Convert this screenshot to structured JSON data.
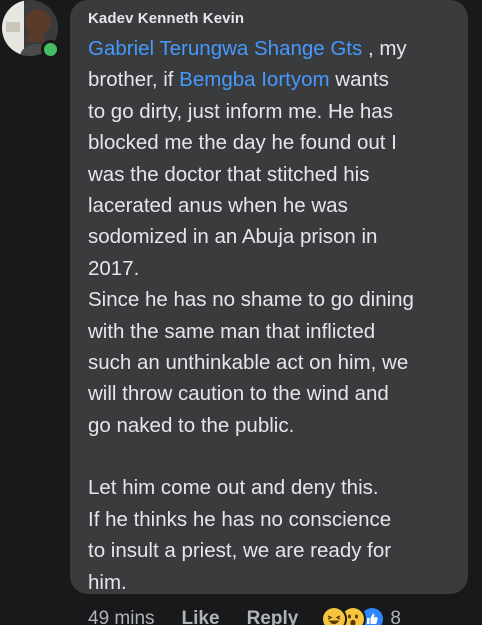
{
  "comment": {
    "author": "Kadev Kenneth Kevin",
    "lines": [
      [
        {
          "t": "Gabriel Terungwa Shange Gts",
          "m": true
        },
        {
          "t": " , my",
          "m": false
        }
      ],
      [
        {
          "t": "brother, if ",
          "m": false
        },
        {
          "t": "Bemgba Iortyom",
          "m": true
        },
        {
          "t": " wants",
          "m": false
        }
      ],
      [
        {
          "t": "to go dirty, just inform me. He has",
          "m": false
        }
      ],
      [
        {
          "t": "blocked me the day he found out I",
          "m": false
        }
      ],
      [
        {
          "t": "was the doctor that stitched his",
          "m": false
        }
      ],
      [
        {
          "t": "lacerated anus when he was",
          "m": false
        }
      ],
      [
        {
          "t": "sodomized in an Abuja prison in",
          "m": false
        }
      ],
      [
        {
          "t": "2017.",
          "m": false
        }
      ],
      [
        {
          "t": "Since he has no shame to go dining",
          "m": false
        }
      ],
      [
        {
          "t": "with the same man that inflicted",
          "m": false
        }
      ],
      [
        {
          "t": "such an unthinkable act on him, we",
          "m": false
        }
      ],
      [
        {
          "t": "will throw caution to the wind and",
          "m": false
        }
      ],
      [
        {
          "t": "go naked to the public.",
          "m": false
        }
      ],
      [],
      [
        {
          "t": "Let him come out and deny this.",
          "m": false
        }
      ],
      [
        {
          "t": "If he thinks he has no conscience",
          "m": false
        }
      ],
      [
        {
          "t": "to insult a priest, we are ready for",
          "m": false
        }
      ],
      [
        {
          "t": "him.",
          "m": false
        }
      ]
    ]
  },
  "actions": {
    "time": "49 mins",
    "like": "Like",
    "reply": "Reply",
    "reaction_icons": [
      "haha-icon",
      "wow-icon",
      "like-icon"
    ],
    "reaction_count": "8"
  },
  "colors": {
    "background": "#18191a",
    "bubble": "#3a3b3c",
    "text": "#e4e6eb",
    "mention": "#4599ff",
    "secondary": "#b0b3b8",
    "online": "#45bd62"
  }
}
